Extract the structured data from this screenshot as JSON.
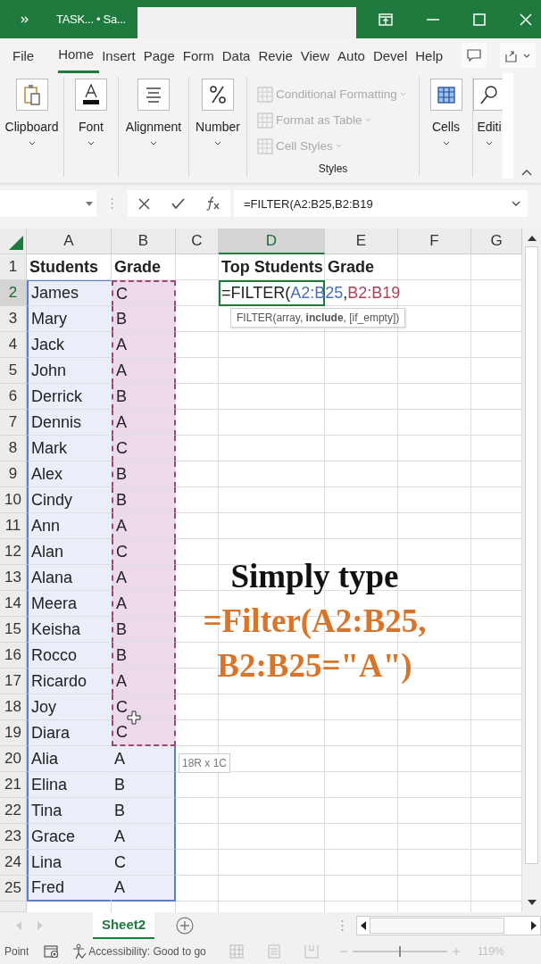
{
  "window": {
    "title": "TASK... • Sa..."
  },
  "tabs": [
    {
      "label": "File",
      "selected": false
    },
    {
      "label": "Home",
      "selected": true
    },
    {
      "label": "Insert",
      "selected": false
    },
    {
      "label": "Page",
      "selected": false
    },
    {
      "label": "Form",
      "selected": false
    },
    {
      "label": "Data",
      "selected": false
    },
    {
      "label": "Revie",
      "selected": false
    },
    {
      "label": "View",
      "selected": false
    },
    {
      "label": "Auto",
      "selected": false
    },
    {
      "label": "Devel",
      "selected": false
    },
    {
      "label": "Help",
      "selected": false
    }
  ],
  "ribbon": {
    "groups": [
      {
        "kind": "button",
        "label": "Clipboard"
      },
      {
        "kind": "button",
        "label": "Font"
      },
      {
        "kind": "button",
        "label": "Alignment"
      },
      {
        "kind": "button",
        "label": "Number"
      },
      {
        "kind": "list",
        "label": "Styles",
        "items": [
          {
            "label": "Conditional Formatting",
            "disabled": true
          },
          {
            "label": "Format as Table",
            "disabled": true
          },
          {
            "label": "Cell Styles",
            "disabled": true
          }
        ]
      },
      {
        "kind": "button",
        "label": "Cells"
      },
      {
        "kind": "button",
        "label": "Editi"
      }
    ]
  },
  "formula_bar": {
    "value": "=FILTER(A2:B25,B2:B19"
  },
  "columns": [
    {
      "label": "A",
      "selected": false
    },
    {
      "label": "B",
      "selected": false
    },
    {
      "label": "C",
      "selected": false
    },
    {
      "label": "D",
      "selected": true
    },
    {
      "label": "E",
      "selected": false
    },
    {
      "label": "F",
      "selected": false
    },
    {
      "label": "G",
      "selected": false
    }
  ],
  "header_row": {
    "row": "1",
    "a": "Students",
    "b": "Grade",
    "d": "Top Students",
    "e": "Grade"
  },
  "rows": [
    {
      "row": "2",
      "name": "James",
      "grade": "C",
      "in_array": true,
      "in_include": true,
      "selected": true,
      "entry": [
        {
          "text": "=FILTER("
        },
        {
          "text": "A2:B25",
          "color": "#4a6fb0"
        },
        {
          "text": ","
        },
        {
          "text": "B2:B19",
          "color": "#b0405a"
        }
      ]
    },
    {
      "row": "3",
      "name": "Mary",
      "grade": "B",
      "in_array": true,
      "in_include": true,
      "selected": false
    },
    {
      "row": "4",
      "name": "Jack",
      "grade": "A",
      "in_array": true,
      "in_include": true,
      "selected": false
    },
    {
      "row": "5",
      "name": "John",
      "grade": "A",
      "in_array": true,
      "in_include": true,
      "selected": false
    },
    {
      "row": "6",
      "name": "Derrick",
      "grade": "B",
      "in_array": true,
      "in_include": true,
      "selected": false
    },
    {
      "row": "7",
      "name": "Dennis",
      "grade": "A",
      "in_array": true,
      "in_include": true,
      "selected": false
    },
    {
      "row": "8",
      "name": "Mark",
      "grade": "C",
      "in_array": true,
      "in_include": true,
      "selected": false
    },
    {
      "row": "9",
      "name": "Alex",
      "grade": "B",
      "in_array": true,
      "in_include": true,
      "selected": false
    },
    {
      "row": "10",
      "name": "Cindy",
      "grade": "B",
      "in_array": true,
      "in_include": true,
      "selected": false
    },
    {
      "row": "11",
      "name": "Ann",
      "grade": "A",
      "in_array": true,
      "in_include": true,
      "selected": false
    },
    {
      "row": "12",
      "name": "Alan",
      "grade": "C",
      "in_array": true,
      "in_include": true,
      "selected": false
    },
    {
      "row": "13",
      "name": "Alana",
      "grade": "A",
      "in_array": true,
      "in_include": true,
      "selected": false
    },
    {
      "row": "14",
      "name": "Meera",
      "grade": "A",
      "in_array": true,
      "in_include": true,
      "selected": false
    },
    {
      "row": "15",
      "name": "Keisha",
      "grade": "B",
      "in_array": true,
      "in_include": true,
      "selected": false
    },
    {
      "row": "16",
      "name": "Rocco",
      "grade": "B",
      "in_array": true,
      "in_include": true,
      "selected": false
    },
    {
      "row": "17",
      "name": "Ricardo",
      "grade": "A",
      "in_array": true,
      "in_include": true,
      "selected": false
    },
    {
      "row": "18",
      "name": "Joy",
      "grade": "C",
      "in_array": true,
      "in_include": true,
      "selected": false
    },
    {
      "row": "19",
      "name": "Diara",
      "grade": "C",
      "in_array": true,
      "in_include": true,
      "selected": false
    },
    {
      "row": "20",
      "name": "Alia",
      "grade": "A",
      "in_array": true,
      "in_include": false,
      "selected": false
    },
    {
      "row": "21",
      "name": "Elina",
      "grade": "B",
      "in_array": true,
      "in_include": false,
      "selected": false
    },
    {
      "row": "22",
      "name": "Tina",
      "grade": "B",
      "in_array": true,
      "in_include": false,
      "selected": false
    },
    {
      "row": "23",
      "name": "Grace",
      "grade": "A",
      "in_array": true,
      "in_include": false,
      "selected": false
    },
    {
      "row": "24",
      "name": "Lina",
      "grade": "C",
      "in_array": true,
      "in_include": false,
      "selected": false
    },
    {
      "row": "25",
      "name": "Fred",
      "grade": "A",
      "in_array": true,
      "in_include": false,
      "selected": false
    }
  ],
  "function_tooltip": "FILTER(array, **include**, [if_empty])",
  "size_tooltip": "18R x 1C",
  "overlay": {
    "lines": [
      {
        "text": "Simply type",
        "kind": "plain"
      },
      {
        "text": "=Filter(A2:B25,",
        "kind": "formula"
      },
      {
        "text": "B2:B25=\"A\")",
        "kind": "formula"
      }
    ]
  },
  "sheet_tabs": [
    {
      "label": "Sheet2",
      "selected": true
    }
  ],
  "status_bar": {
    "mode": "Point",
    "accessibility": "Accessibility: Good to go",
    "zoom": "119%"
  },
  "zoom_slider": {
    "level": 0.5
  }
}
